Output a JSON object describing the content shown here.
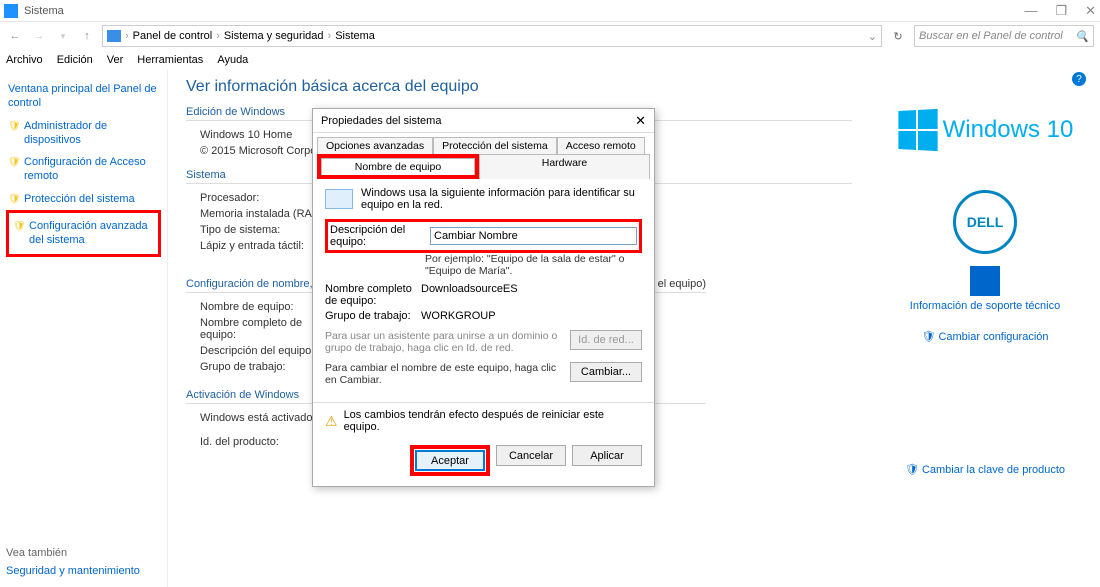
{
  "titlebar": {
    "title": "Sistema"
  },
  "navbar": {
    "breadcrumb": [
      "Panel de control",
      "Sistema y seguridad",
      "Sistema"
    ],
    "search_placeholder": "Buscar en el Panel de control"
  },
  "menubar": [
    "Archivo",
    "Edición",
    "Ver",
    "Herramientas",
    "Ayuda"
  ],
  "sidebar": {
    "items": [
      {
        "label": "Ventana principal del Panel de control",
        "shield": false
      },
      {
        "label": "Administrador de dispositivos",
        "shield": true
      },
      {
        "label": "Configuración de Acceso remoto",
        "shield": true
      },
      {
        "label": "Protección del sistema",
        "shield": true
      },
      {
        "label": "Configuración avanzada del sistema",
        "shield": true,
        "highlighted": true
      }
    ],
    "vea_tambien": "Vea también",
    "sec_maint": "Seguridad y mantenimiento"
  },
  "content": {
    "heading": "Ver información básica acerca del equipo",
    "edicion_title": "Edición de Windows",
    "edicion": {
      "os": "Windows 10 Home",
      "copyright": "© 2015 Microsoft Corpo"
    },
    "sistema_title": "Sistema",
    "sistema": {
      "procesador_k": "Procesador:",
      "memoria_k": "Memoria instalada (RAM",
      "tipo_k": "Tipo de sistema:",
      "lapiz_k": "Lápiz y entrada táctil:"
    },
    "config_title": "Configuración de nombre,",
    "config": {
      "nombre_k": "Nombre de equipo:",
      "nombre_full_k": "Nombre completo de equipo:",
      "desc_k": "Descripción del equipo:",
      "grupo_k": "Grupo de trabajo:",
      "suffix": "el equipo)"
    },
    "activ_title": "Activación de Windows",
    "activ": {
      "estado_k": "Windows está activado",
      "id_k": "Id. del producto:"
    }
  },
  "brand": {
    "win_text": "Windows 10",
    "dell": "DELL",
    "soporte": "Información de soporte técnico",
    "cambiar_conf": "Cambiar configuración",
    "clave": "Cambiar la clave de producto"
  },
  "dialog": {
    "title": "Propiedades del sistema",
    "tabs_row1": [
      "Opciones avanzadas",
      "Protección del sistema",
      "Acceso remoto"
    ],
    "tabs_row2": [
      "Nombre de equipo",
      "Hardware"
    ],
    "info_text": "Windows usa la siguiente información para identificar su equipo en la red.",
    "desc_label": "Descripción del equipo:",
    "desc_value": "Cambiar Nombre",
    "example": "Por ejemplo: \"Equipo de la sala de estar\" o \"Equipo de María\".",
    "nombre_completo_k": "Nombre completo de equipo:",
    "nombre_completo_v": "DownloadsourceES",
    "grupo_k": "Grupo de trabajo:",
    "grupo_v": "WORKGROUP",
    "asistente_text": "Para usar un asistente para unirse a un dominio o grupo de trabajo, haga clic en Id. de red.",
    "id_red_btn": "Id. de red...",
    "cambiar_text": "Para cambiar el nombre de este equipo, haga clic en Cambiar.",
    "cambiar_btn": "Cambiar...",
    "warn_text": "Los cambios tendrán efecto después de reiniciar este equipo.",
    "aceptar": "Aceptar",
    "cancelar": "Cancelar",
    "aplicar": "Aplicar"
  }
}
